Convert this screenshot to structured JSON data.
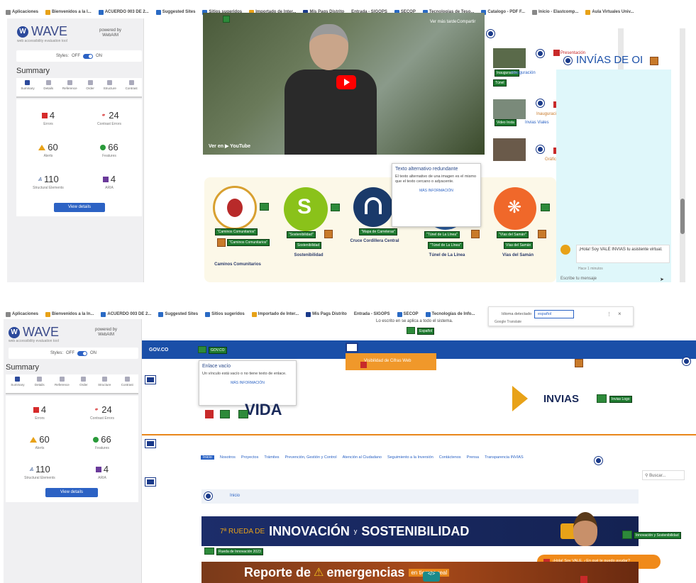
{
  "top": {
    "bookmarks": [
      "Aplicaciones",
      "Bienvenidos a la I...",
      "ACUERDO 003 DE 2...",
      "Suggested Sites",
      "Sitios sugeridos",
      "Importado de Inter...",
      "Mis Pags Distrito",
      "Entrada - SIGOPS",
      "SECOP",
      "Tecnologias de Teso...",
      "Catalogo - PDF F...",
      "Inicio - Elastcomp...",
      "Aula Virtuales Univ..."
    ],
    "wave": {
      "logo": "WAVE",
      "powered_by": "powered by",
      "webaim": "WebAIM",
      "tagline": "web accessibility evaluation tool",
      "styles_label": "Styles:",
      "off": "OFF",
      "on": "ON"
    },
    "summary_title": "Summary",
    "tabs": [
      "Summary",
      "Details",
      "Reference",
      "Order",
      "Structure",
      "Contrast"
    ],
    "stats": [
      {
        "icon": "error-icon",
        "value": "4",
        "label": "Errors"
      },
      {
        "icon": "contrast-icon",
        "value": "24",
        "label": "Contrast Errors"
      },
      {
        "icon": "alert-icon",
        "value": "60",
        "label": "Alerts"
      },
      {
        "icon": "feature-icon",
        "value": "66",
        "label": "Features"
      },
      {
        "icon": "structure-icon",
        "value": "110",
        "label": "Structural Elements"
      },
      {
        "icon": "aria-icon",
        "value": "4",
        "label": "ARIA"
      }
    ],
    "view_details": "View details",
    "video": {
      "header_left": "...",
      "watch_later": "Ver más tarde",
      "share": "Compartir",
      "watch_on": "Ver en",
      "youtube": "YouTube"
    },
    "right_col": {
      "brand": "INVÍAS DE OI",
      "label1": "Presentación",
      "label2": "Inauguración",
      "label3": "Túnel",
      "label4": "Video Insta",
      "item_a": "Inauguración",
      "item_b": "Invias Viales",
      "item_c": "Gráfico de..."
    },
    "tooltip": {
      "title": "Texto alternativo redundante",
      "body": "El texto alternativo de una imagen es el mismo que el texto cercano o adyacente.",
      "more": "MÁS INFORMACIÓN"
    },
    "cards": [
      {
        "tag": "\"Caminos Comunitarios\"",
        "tag2": "\"Caminos Comunitarios\"",
        "title": "Caminos Comunitarios"
      },
      {
        "tag": "\"Sostenibilidad\"",
        "tag2": "Sostenibilidad",
        "title": "Sostenibilidad"
      },
      {
        "tag": "\"Mapa de Carreteras\"",
        "tag2": "",
        "title": "Cruce Cordillera Central"
      },
      {
        "tag": "\"Túnel de La Línea\"",
        "tag2": "\"Túnel de La Línea\"",
        "title": "Túnel de La Línea"
      },
      {
        "tag": "\"Vías del Samán\"",
        "tag2": "Vías del Samán",
        "title": "Vías del Samán"
      }
    ],
    "chat": {
      "msg": "¡Hola! Soy VALE INVIAS tu asistente virtual.",
      "time": "Hace 1 minutos",
      "placeholder": "Escribe tu mensaje"
    }
  },
  "bottom": {
    "bookmarks": [
      "Aplicaciones",
      "Bienvenidos a la In...",
      "ACUERDO 003 DE 2...",
      "Suggested Sites",
      "Sitios sugeridos",
      "Importado de Inter...",
      "Mis Pags Distrito",
      "Entrada - SIGOPS",
      "SECOP",
      "Tecnologías de Info..."
    ],
    "translate": {
      "label": "Idioma detectado",
      "lang": "español",
      "google": "Google Translate"
    },
    "top_msg": "Lo escrito en se aplica a todo el sistema.",
    "top_tag": "Español",
    "govco": "GOV.CO",
    "gov_tag": "GOV.CO",
    "tooltip": {
      "title": "Enlace vacío",
      "body": "Un vínculo está vacío o no tiene texto de enlace.",
      "more": "MÁS INFORMACIÓN"
    },
    "orange_btn": "Visibilidad de Cifras Web",
    "vida": "VIDA",
    "invias": "INVIAS",
    "invias_tag": "Invias Logo",
    "nav": [
      "Inicio",
      "Nosotros",
      "Proyectos",
      "Trámites",
      "Prevención, Gestión y Control",
      "Atención al Ciudadano",
      "Seguimiento a la Inversión",
      "Contáctenos",
      "Prensa",
      "Transparencia INVIAS"
    ],
    "search": "Buscar...",
    "breadcrumb": "Inicio",
    "banner1": {
      "pre": "7ª RUEDA DE",
      "main": "INNOVACIÓN",
      "y": "y",
      "main2": "SOSTENIBILIDAD",
      "tag": "Innovación y Sostenibilidad"
    },
    "banner1_tag": "Rueda de Innovación 2023",
    "banner2": {
      "a": "Reporte de",
      "b": "emergencias",
      "c": "en tiempo real"
    },
    "chat_label": "¡Hola! Soy VALE. ¿En qué te puedo ayudar?",
    "wave": {
      "logo": "WAVE",
      "powered_by": "powered by",
      "webaim": "WebAIM",
      "tagline": "web accessibility evaluation tool",
      "styles_label": "Styles:",
      "off": "OFF",
      "on": "ON"
    },
    "summary_title": "Summary",
    "tabs": [
      "Summary",
      "Details",
      "Reference",
      "Order",
      "Structure",
      "Contrast"
    ],
    "stats": [
      {
        "icon": "error-icon",
        "value": "4",
        "label": "Errors"
      },
      {
        "icon": "contrast-icon",
        "value": "24",
        "label": "Contrast Errors"
      },
      {
        "icon": "alert-icon",
        "value": "60",
        "label": "Alerts"
      },
      {
        "icon": "feature-icon",
        "value": "66",
        "label": "Features"
      },
      {
        "icon": "structure-icon",
        "value": "110",
        "label": "Structural Elements"
      },
      {
        "icon": "aria-icon",
        "value": "4",
        "label": "ARIA"
      }
    ],
    "view_details": "View details"
  },
  "colors": {
    "wave_blue": "#2c4a9c",
    "navy": "#1a4fa8",
    "orange": "#e8861a",
    "green_tag": "#1f7a30",
    "cyan": "#dff7fa"
  }
}
